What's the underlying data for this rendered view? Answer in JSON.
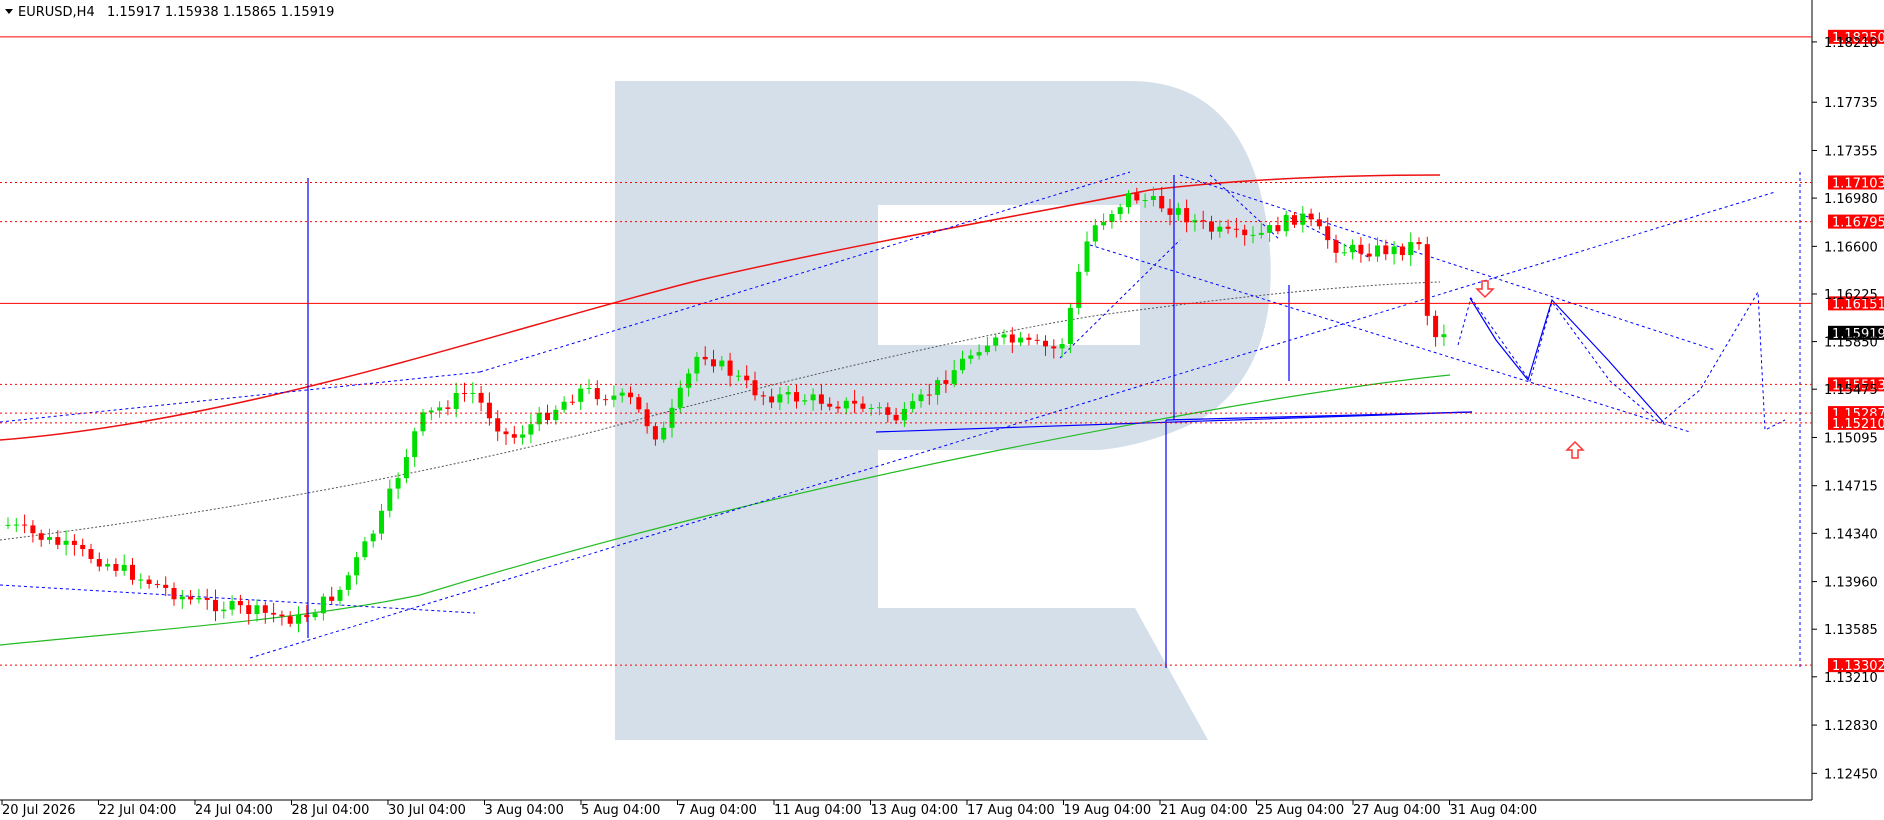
{
  "header": {
    "symbol": "EURUSD,H4",
    "ohlc": "1.15917 1.15938 1.15865 1.15919"
  },
  "chart_data": {
    "type": "candlestick",
    "ylim": [
      1.1224,
      1.1854
    ],
    "y_ticks": [
      "1.18210",
      "1.17735",
      "1.17355",
      "1.16980",
      "1.16600",
      "1.16225",
      "1.15850",
      "1.15475",
      "1.15095",
      "1.14715",
      "1.14340",
      "1.13960",
      "1.13585",
      "1.13210",
      "1.12830",
      "1.12450"
    ],
    "x_ticks": [
      "20 Jul 2026",
      "22 Jul 04:00",
      "24 Jul 04:00",
      "28 Jul 04:00",
      "30 Jul 04:00",
      "3 Aug 04:00",
      "5 Aug 04:00",
      "7 Aug 04:00",
      "11 Aug 04:00",
      "13 Aug 04:00",
      "17 Aug 04:00",
      "19 Aug 04:00",
      "21 Aug 04:00",
      "25 Aug 04:00",
      "27 Aug 04:00",
      "31 Aug 04:00"
    ],
    "horizontal_levels": [
      {
        "label": "1.18250",
        "value": 1.1825,
        "style": "solid"
      },
      {
        "label": "1.17103",
        "value": 1.17103,
        "style": "dotted"
      },
      {
        "label": "1.16795",
        "value": 1.16795,
        "style": "dotted"
      },
      {
        "label": "1.16151",
        "value": 1.16151,
        "style": "solid"
      },
      {
        "label": "1.15513",
        "value": 1.15513,
        "style": "dotted"
      },
      {
        "label": "1.15287",
        "value": 1.15287,
        "style": "dotted"
      },
      {
        "label": "1.15210",
        "value": 1.1521,
        "style": "dotted"
      },
      {
        "label": "1.13302",
        "value": 1.13302,
        "style": "dotted"
      }
    ],
    "current_price": {
      "label": "1.15919",
      "value": 1.15919
    },
    "colors": {
      "up": "#00dd00",
      "down": "#ff0000",
      "level": "#ff0000",
      "trend": "#0000ff",
      "ma_slow": "#ee1111",
      "ma_fast": "#22bb22"
    }
  }
}
